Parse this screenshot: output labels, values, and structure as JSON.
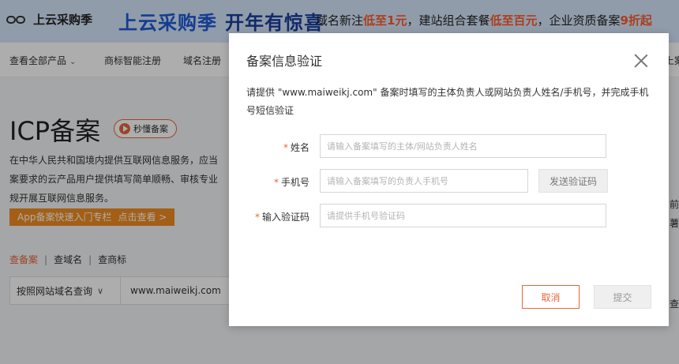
{
  "banner": {
    "logo_text": "上云采购季",
    "headline_1": "上云采购季",
    "headline_2": "开年有惊喜",
    "promo_1": "域名新注",
    "promo_2": "低至1元",
    "promo_3": "，建站组合套餐",
    "promo_4": "低至百元",
    "promo_5": "，企业资质备案",
    "promo_6": "9折起"
  },
  "nav": {
    "items": [
      "查看全部产品",
      "商标智能注册",
      "域名注册"
    ],
    "right_fragment": "上案"
  },
  "hero": {
    "title": "ICP备案",
    "badge": "秒懂备案",
    "desc_lines": [
      "在中华人民共和国境内提供互联网信息服务，应当",
      "案要求的云产品用户提供填写简单顺畅、审核专业",
      "规开展互联网信息服务。"
    ],
    "entry_label": "App备案快速入门专栏",
    "entry_link": "点击查看 >",
    "query_tabs": [
      "查备案",
      "查域名",
      "查商标"
    ],
    "query_select": "按照网站域名查询",
    "query_value": "www.maiweikj.com",
    "side_fragments": [
      "前",
      "薯",
      "查"
    ]
  },
  "modal": {
    "title": "备案信息验证",
    "description": "请提供 \"www.maiweikj.com\" 备案时填写的主体负责人或网站负责人姓名/手机号，并完成手机号短信验证",
    "fields": [
      {
        "label": "姓名",
        "placeholder": "请输入备案填写的主体/网站负责人姓名"
      },
      {
        "label": "手机号",
        "placeholder": "请输入备案填写的负责人手机号"
      },
      {
        "label": "输入验证码",
        "placeholder": "请提供手机号验证码"
      }
    ],
    "required_mark": "*",
    "send_code_label": "发送验证码",
    "cancel_label": "取消",
    "submit_label": "提交"
  }
}
